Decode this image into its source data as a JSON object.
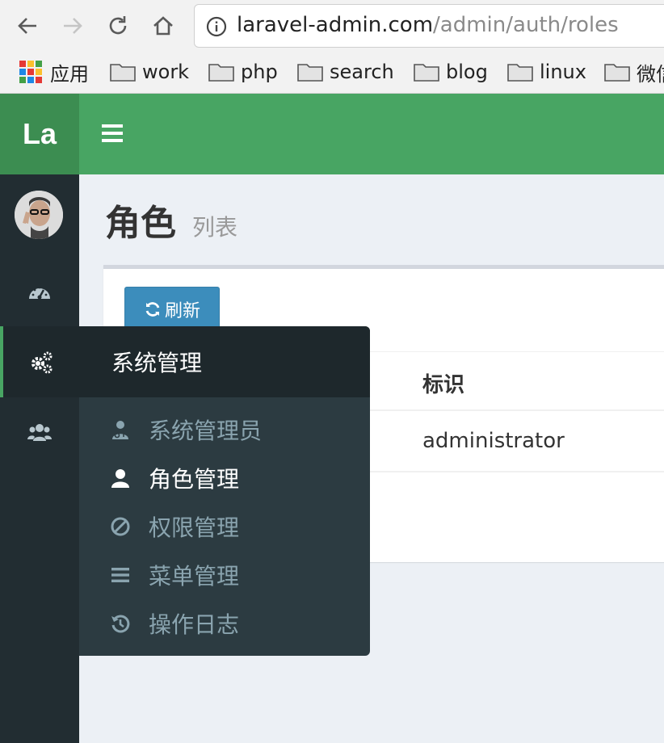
{
  "browser": {
    "url_host": "laravel-admin.com",
    "url_path": "/admin/auth/roles",
    "bookmarks": [
      {
        "label": "应用",
        "icon": "apps-grid-icon"
      },
      {
        "label": "work",
        "icon": "folder-icon"
      },
      {
        "label": "php",
        "icon": "folder-icon"
      },
      {
        "label": "search",
        "icon": "folder-icon"
      },
      {
        "label": "blog",
        "icon": "folder-icon"
      },
      {
        "label": "linux",
        "icon": "folder-icon"
      },
      {
        "label": "微信",
        "icon": "folder-icon"
      }
    ]
  },
  "header": {
    "logo": "La"
  },
  "content": {
    "title": "角色",
    "subtitle": "列表",
    "refresh_label": "刷新",
    "table": {
      "columns": [
        "标识"
      ],
      "rows": [
        [
          "administrator"
        ]
      ]
    }
  },
  "flyout": {
    "title": "系统管理",
    "items": [
      {
        "label": "系统管理员",
        "icon": "user-md-icon",
        "active": false
      },
      {
        "label": "角色管理",
        "icon": "user-icon",
        "active": true
      },
      {
        "label": "权限管理",
        "icon": "ban-icon",
        "active": false
      },
      {
        "label": "菜单管理",
        "icon": "bars-icon",
        "active": false
      },
      {
        "label": "操作日志",
        "icon": "history-icon",
        "active": false
      }
    ]
  },
  "colors": {
    "header_green": "#48a563",
    "logo_green": "#3c8d51",
    "sidebar_dark": "#222d32",
    "button_blue": "#3c8dbc"
  }
}
